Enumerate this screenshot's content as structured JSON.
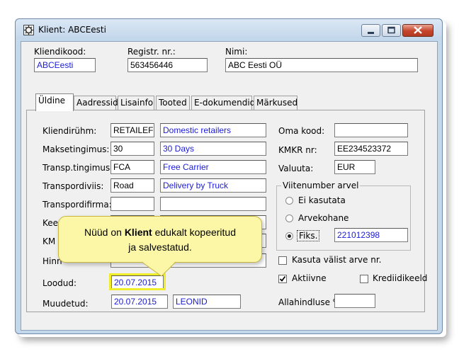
{
  "window": {
    "title": "Klient: ABCEesti"
  },
  "header": {
    "kliendikood": {
      "label": "Kliendikood:",
      "value": "ABCEesti"
    },
    "registr": {
      "label": "Registr. nr.:",
      "value": "563456446"
    },
    "nimi": {
      "label": "Nimi:",
      "value": "ABC Eesti OÜ"
    }
  },
  "tabs": [
    "Üldine",
    "Aadressid",
    "Lisainfo",
    "Tooted",
    "E-dokumendid",
    "Märkused"
  ],
  "left": {
    "kliendiruhm": {
      "label": "Kliendirühm:",
      "code": "RETAILEF",
      "desc": "Domestic retailers"
    },
    "maksetingimus": {
      "label": "Maksetingimus:",
      "code": "30",
      "desc": "30 Days"
    },
    "transp": {
      "label": "Transp.tingimus:",
      "code": "FCA",
      "desc": "Free Carrier"
    },
    "transpordiviis": {
      "label": "Transpordiviis:",
      "code": "Road",
      "desc": "Delivery by Truck"
    },
    "transpordifirma": {
      "label": "Transpordifirma:",
      "code": "",
      "desc": ""
    },
    "kee": {
      "label": "Kee"
    },
    "km": {
      "label": "KM"
    },
    "hinn": {
      "label": "Hinn"
    },
    "loodud": {
      "label": "Loodud:",
      "date": "20.07.2015"
    },
    "muudetud": {
      "label": "Muudetud:",
      "date": "20.07.2015",
      "user": "LEONID"
    }
  },
  "right": {
    "oma_kood": {
      "label": "Oma kood:",
      "value": ""
    },
    "kmkr": {
      "label": "KMKR nr:",
      "value": "EE234523372"
    },
    "valuuta": {
      "label": "Valuuta:",
      "value": "EUR"
    },
    "viitenumber": {
      "title": "Viitenumber arvel",
      "options": [
        "Ei kasutata",
        "Arvekohane",
        "Fiks."
      ],
      "selected": "Fiks.",
      "value": "221012398"
    },
    "kasuta_valist": {
      "label": "Kasuta välist arve nr.",
      "checked": false
    },
    "aktiivne": {
      "label": "Aktiivne",
      "checked": true
    },
    "krediidikeeld": {
      "label": "Krediidikeeld",
      "checked": false
    },
    "allahindlus": {
      "label": "Allahindluse %:",
      "value": ""
    }
  },
  "callout": {
    "text_before": "Nüüd on ",
    "text_bold": "Klient",
    "text_after": " edukalt kopeeritud",
    "line2": "ja salvestatud."
  }
}
